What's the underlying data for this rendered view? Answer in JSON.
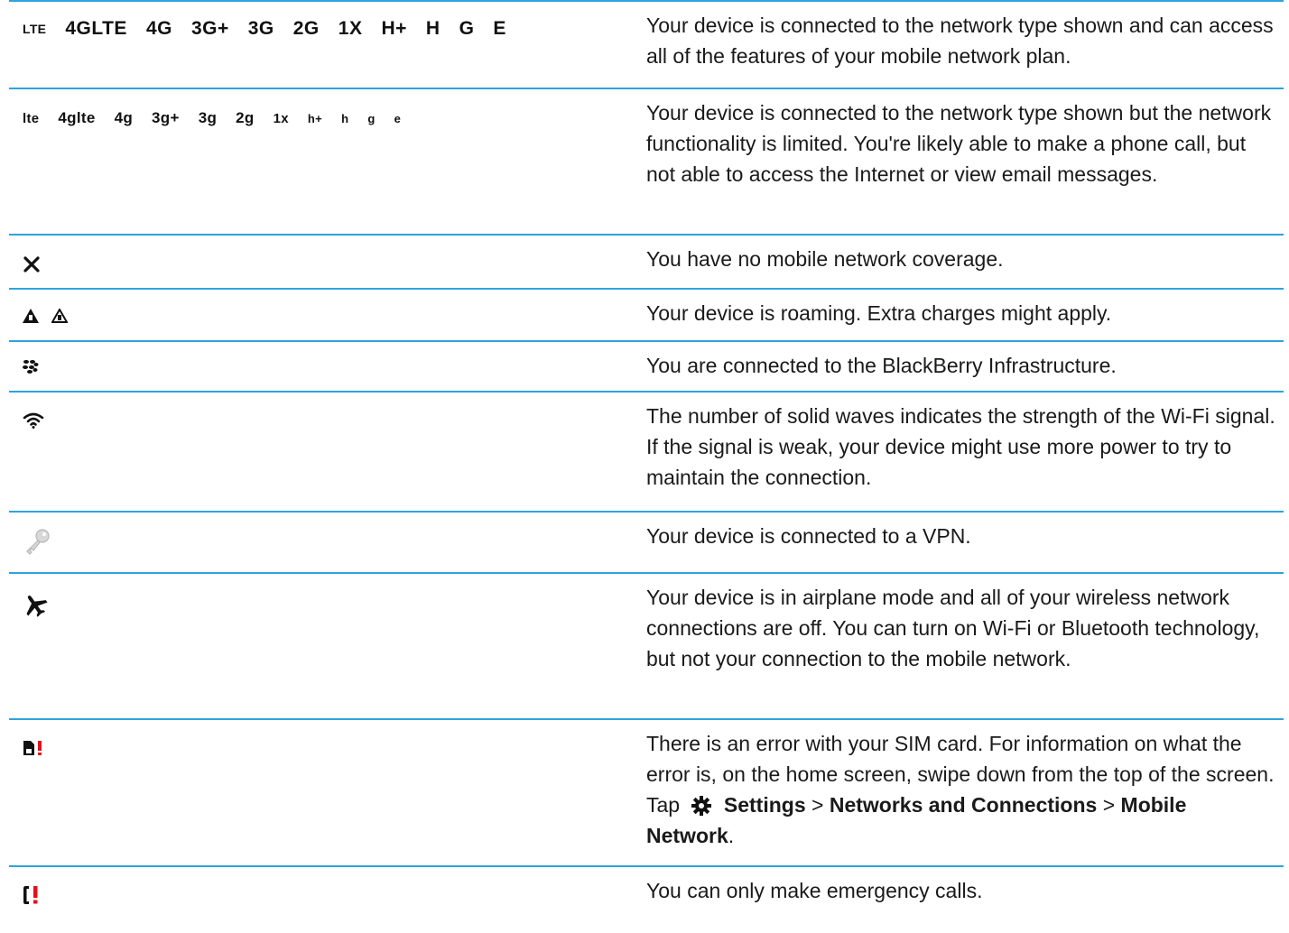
{
  "rows": [
    {
      "icons": [
        "LTE",
        "4GLTE",
        "4G",
        "3G+",
        "3G",
        "2G",
        "1X",
        "H+",
        "H",
        "G",
        "E"
      ],
      "text": "Your device is connected to the network type shown and can access all of the features of your mobile network plan."
    },
    {
      "icons": [
        "lte",
        "4glte",
        "4g",
        "3g+",
        "3g",
        "2g",
        "1x",
        "h+",
        "h",
        "g",
        "e"
      ],
      "text": "Your device is connected to the network type shown but the network functionality is limited. You're likely able to make a phone call, but not able to access the Internet or view email messages."
    },
    {
      "icon": "no-coverage-x-icon",
      "text": "You have no mobile network coverage."
    },
    {
      "icon": "roaming-triangle-icon",
      "text": "Your device is roaming. Extra charges might apply."
    },
    {
      "icon": "blackberry-logo-icon",
      "text": "You are connected to the BlackBerry Infrastructure."
    },
    {
      "icon": "wifi-icon",
      "text": "The number of solid waves indicates the strength of the Wi-Fi signal. If the signal is weak, your device might use more power to try to maintain the connection."
    },
    {
      "icon": "vpn-key-icon",
      "text": "Your device is connected to a VPN."
    },
    {
      "icon": "airplane-icon",
      "text": "Your device is in airplane mode and all of your wireless network connections are off. You can turn on Wi-Fi or Bluetooth technology, but not your connection to the mobile network."
    },
    {
      "icon": "sim-error-icon",
      "text_before": "There is an error with your SIM card. For information on what the error is, on the home screen, swipe down from the top of the screen. Tap",
      "settings": "Settings",
      "sep1": ">",
      "networks": "Networks and Connections",
      "sep2": ">",
      "mobile": "Mobile Network",
      "end": "."
    },
    {
      "icon": "emergency-call-icon",
      "text": "You can only make emergency calls."
    }
  ],
  "colors": {
    "rule": "#2ea3dd",
    "alert": "#e3101d"
  }
}
